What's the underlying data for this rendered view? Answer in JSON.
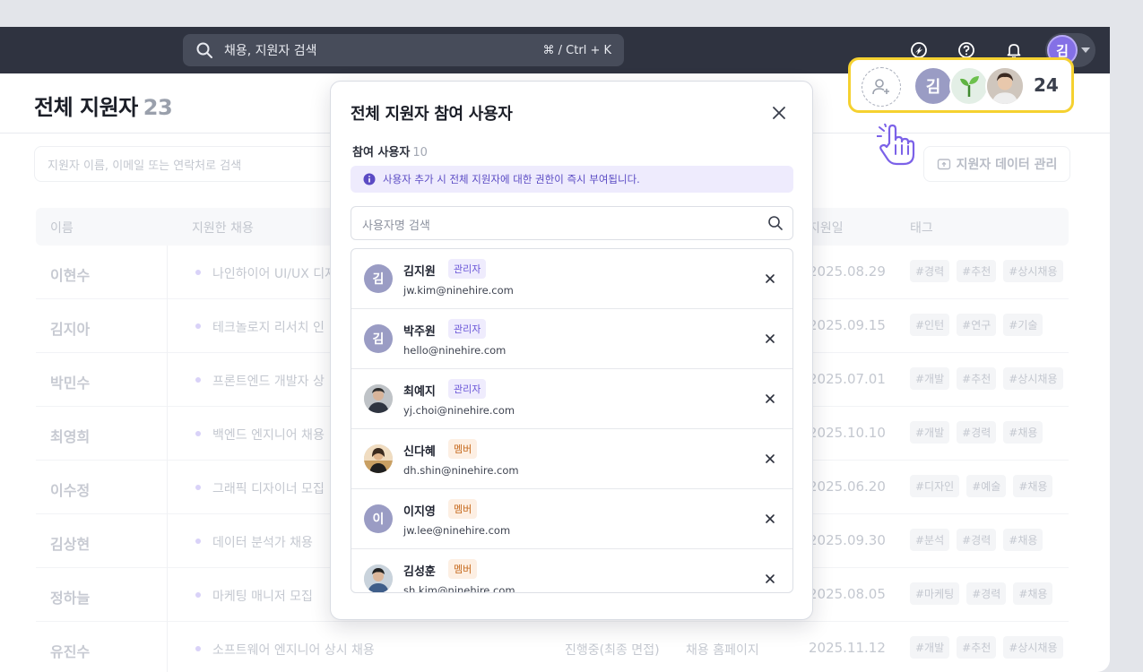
{
  "topbar": {
    "search_placeholder": "채용, 지원자 검색",
    "shortcut": "⌘ / Ctrl + K",
    "user_initial": "김"
  },
  "page": {
    "title": "전체 지원자",
    "count": "23",
    "collaborators_count": "24",
    "collaborator_initial": "김",
    "filter_placeholder": "지원자 이름, 이메일 또는 연락처로 검색",
    "data_button": "지원자 데이터 관리"
  },
  "table": {
    "headers": {
      "name": "이름",
      "job": "지원한 채용",
      "date": "지원일",
      "tags": "태그"
    },
    "rows": [
      {
        "name": "이현수",
        "job": "나인하이어 UI/UX 디자",
        "status": "",
        "source": "",
        "date": "2025.08.29",
        "tags": [
          "#경력",
          "#추천",
          "#상시채용"
        ]
      },
      {
        "name": "김지아",
        "job": "테크놀로지 리서치 인",
        "status": "",
        "source": "",
        "date": "2025.09.15",
        "tags": [
          "#인턴",
          "#연구",
          "#기술"
        ]
      },
      {
        "name": "박민수",
        "job": "프론트엔드 개발자 상",
        "status": "",
        "source": "",
        "date": "2025.07.01",
        "tags": [
          "#개발",
          "#추천",
          "#상시채용"
        ]
      },
      {
        "name": "최영희",
        "job": "백엔드 엔지니어 채용",
        "status": "",
        "source": "",
        "date": "2025.10.10",
        "tags": [
          "#개발",
          "#경력",
          "#채용"
        ]
      },
      {
        "name": "이수정",
        "job": "그래픽 디자이너 모집",
        "status": "",
        "source": "",
        "date": "2025.06.20",
        "tags": [
          "#디자인",
          "#예술",
          "#채용"
        ]
      },
      {
        "name": "김상현",
        "job": "데이터 분석가 채용",
        "status": "",
        "source": "",
        "date": "2025.09.30",
        "tags": [
          "#분석",
          "#경력",
          "#채용"
        ]
      },
      {
        "name": "정하늘",
        "job": "마케팅 매니저 모집",
        "status": "",
        "source": "",
        "date": "2025.08.05",
        "tags": [
          "#마케팅",
          "#경력",
          "#채용"
        ]
      },
      {
        "name": "유진수",
        "job": "소프트웨어 엔지니어 상시 채용",
        "status": "진행중(최종 면접)",
        "source": "채용 홈페이지",
        "date": "2025.11.12",
        "tags": [
          "#개발",
          "#추천",
          "#상시채용"
        ]
      }
    ]
  },
  "modal": {
    "title": "전체 지원자 참여 사용자",
    "participants_label": "참여 사용자",
    "participants_count": "10",
    "notice": "사용자 추가 시 전체 지원자에 대한 권한이 즉시 부여됩니다.",
    "search_placeholder": "사용자명 검색",
    "members": [
      {
        "name": "김지원",
        "role": "관리자",
        "role_type": "admin",
        "email": "jw.kim@ninehire.com",
        "avatar": "initial",
        "initial": "김"
      },
      {
        "name": "박주원",
        "role": "관리자",
        "role_type": "admin",
        "email": "hello@ninehire.com",
        "avatar": "initial",
        "initial": "김"
      },
      {
        "name": "최예지",
        "role": "관리자",
        "role_type": "admin",
        "email": "yj.choi@ninehire.com",
        "avatar": "photo"
      },
      {
        "name": "신다혜",
        "role": "멤버",
        "role_type": "member",
        "email": "dh.shin@ninehire.com",
        "avatar": "photo"
      },
      {
        "name": "이지영",
        "role": "멤버",
        "role_type": "member",
        "email": "jw.lee@ninehire.com",
        "avatar": "initial",
        "initial": "이"
      },
      {
        "name": "김성훈",
        "role": "멤버",
        "role_type": "member",
        "email": "sh.kim@ninehire.com",
        "avatar": "photo"
      }
    ]
  },
  "colors": {
    "accent": "#8470e6",
    "highlight": "#f5d130",
    "topbar": "#2f3340"
  }
}
